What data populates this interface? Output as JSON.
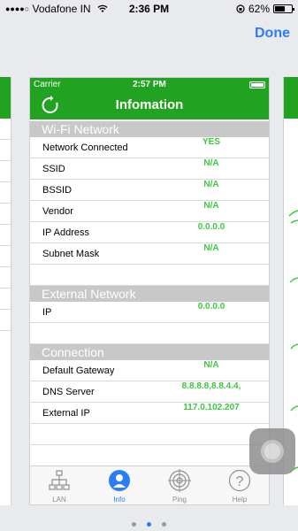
{
  "status_bar": {
    "signal_dots": "●●●●○",
    "carrier": "Vodafone IN",
    "time": "2:36 PM",
    "battery": "62%",
    "battery_level": 0.62
  },
  "header": {
    "done_label": "Done"
  },
  "card": {
    "inner_status": {
      "carrier": "Carrier",
      "time": "2:57 PM"
    },
    "title": "Infomation",
    "sections": {
      "wifi": {
        "title": "Wi-Fi Network",
        "rows": [
          {
            "label": "Network Connected",
            "value": "YES"
          },
          {
            "label": "SSID",
            "value": "N/A"
          },
          {
            "label": "BSSID",
            "value": "N/A"
          },
          {
            "label": "Vendor",
            "value": "N/A"
          },
          {
            "label": "IP Address",
            "value": "0.0.0.0"
          },
          {
            "label": "Subnet Mask",
            "value": "N/A"
          }
        ]
      },
      "external": {
        "title": "External Network",
        "rows": [
          {
            "label": "IP",
            "value": "0.0.0.0"
          }
        ]
      },
      "connection": {
        "title": "Connection",
        "rows": [
          {
            "label": "Default Gateway",
            "value": "N/A"
          },
          {
            "label": "DNS Server",
            "value": "8.8.8.8,8.8.4.4,"
          },
          {
            "label": "External IP",
            "value": "117.0.102.207"
          }
        ]
      }
    },
    "tabs": [
      {
        "label": "LAN",
        "icon": "lan-icon"
      },
      {
        "label": "Info",
        "icon": "person-icon"
      },
      {
        "label": "Ping",
        "icon": "target-icon"
      },
      {
        "label": "Help",
        "icon": "question-icon"
      }
    ]
  },
  "colors": {
    "green": "#21a321",
    "value_green": "#3cc83c",
    "accent_blue": "#2a7df6"
  }
}
